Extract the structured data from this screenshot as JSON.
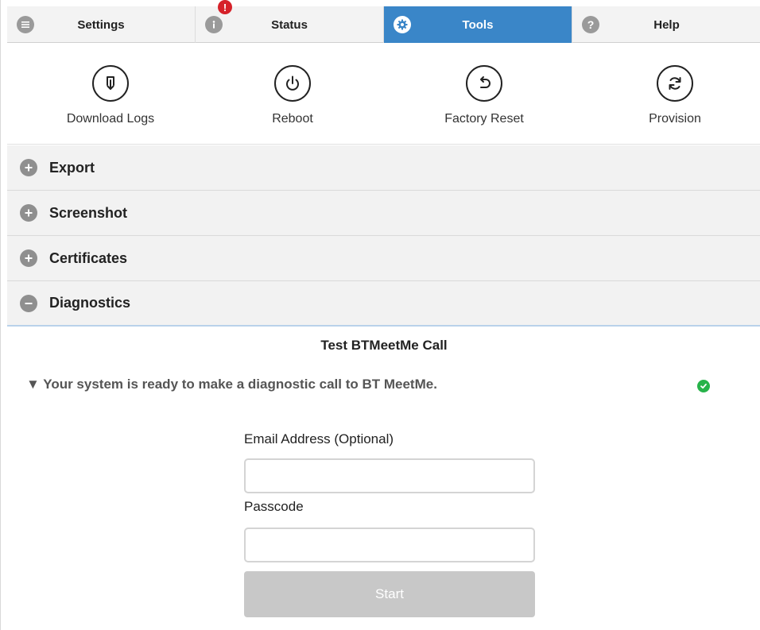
{
  "tabs": [
    {
      "label": "Settings",
      "icon": "list-icon",
      "active": false
    },
    {
      "label": "Status",
      "icon": "info-icon",
      "badge": "!",
      "active": false
    },
    {
      "label": "Tools",
      "icon": "gear-icon",
      "active": true
    },
    {
      "label": "Help",
      "icon": "question-icon",
      "active": false
    }
  ],
  "tools": [
    {
      "label": "Download Logs",
      "icon": "download-icon"
    },
    {
      "label": "Reboot",
      "icon": "power-icon"
    },
    {
      "label": "Factory Reset",
      "icon": "undo-icon"
    },
    {
      "label": "Provision",
      "icon": "sync-icon"
    }
  ],
  "sections": [
    {
      "label": "Export",
      "expanded": false
    },
    {
      "label": "Screenshot",
      "expanded": false
    },
    {
      "label": "Certificates",
      "expanded": false
    },
    {
      "label": "Diagnostics",
      "expanded": true
    }
  ],
  "diagnostics": {
    "title": "Test BTMeetMe Call",
    "status_marker": "▼",
    "status_text": "Your system is ready to make a diagnostic call to BT MeetMe.",
    "email_label": "Email Address (Optional)",
    "email_value": "",
    "passcode_label": "Passcode",
    "passcode_value": "",
    "start_label": "Start"
  },
  "colors": {
    "active_tab": "#3a86c8",
    "badge": "#d6222a",
    "status_ok": "#27b34a",
    "disabled_button": "#c8c8c8"
  }
}
